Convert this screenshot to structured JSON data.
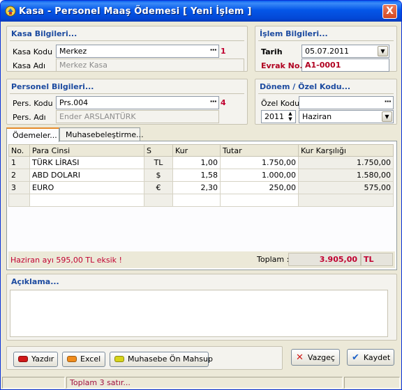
{
  "window": {
    "title": "Kasa - Personel Maaş Ödemesi  [ Yeni İşlem ]",
    "close_label": "X"
  },
  "kasa": {
    "title": "Kasa Bilgileri...",
    "kod_label": "Kasa Kodu",
    "kod_value": "Merkez",
    "kod_badge": "1",
    "ad_label": "Kasa Adı",
    "ad_value": "Merkez Kasa"
  },
  "islem": {
    "title": "İşlem Bilgileri...",
    "tarih_label": "Tarih",
    "tarih_value": "05.07.2011",
    "evrak_label": "Evrak No.",
    "evrak_value": "A1-0001"
  },
  "personel": {
    "title": "Personel Bilgileri...",
    "kod_label": "Pers. Kodu",
    "kod_value": "Prs.004",
    "kod_badge": "4",
    "ad_label": "Pers. Adı",
    "ad_value": "Ender ARSLANTÜRK"
  },
  "donem": {
    "title": "Dönem / Özel Kodu...",
    "ozel_label": "Özel Kodu",
    "ozel_value": "",
    "year": "2011",
    "month": "Haziran"
  },
  "tabs": [
    {
      "label": "Ödemeler..."
    },
    {
      "label": "Muhasebeleştirme..."
    }
  ],
  "grid": {
    "headers": [
      "No.",
      "Para Cinsi",
      "S",
      "Kur",
      "Tutar",
      "Kur Karşılığı"
    ],
    "rows": [
      {
        "no": "1",
        "para": "TÜRK LİRASI",
        "s": "TL",
        "kur": "1,00",
        "tutar": "1.750,00",
        "karsilik": "1.750,00"
      },
      {
        "no": "2",
        "para": "ABD DOLARI",
        "s": "$",
        "kur": "1,58",
        "tutar": "1.000,00",
        "karsilik": "1.580,00"
      },
      {
        "no": "3",
        "para": "EURO",
        "s": "€",
        "kur": "2,30",
        "tutar": "250,00",
        "karsilik": "575,00"
      }
    ],
    "warning": "Haziran ayı 595,00 TL eksik !",
    "toplam_label": "Toplam :",
    "toplam_value": "3.905,00",
    "toplam_currency": "TL"
  },
  "aciklama": {
    "title": "Açıklama...",
    "text": ""
  },
  "buttons": {
    "yazdir": "Yazdır",
    "excel": "Excel",
    "muhasebe": "Muhasebe Ön Mahsup",
    "vazgec": "Vazgeç",
    "kaydet": "Kaydet"
  },
  "status": {
    "text": "Toplam 3 satır..."
  },
  "colors": {
    "accent": "#1d4ba0",
    "alert": "#c00030",
    "titlebar": "#0456e8"
  }
}
